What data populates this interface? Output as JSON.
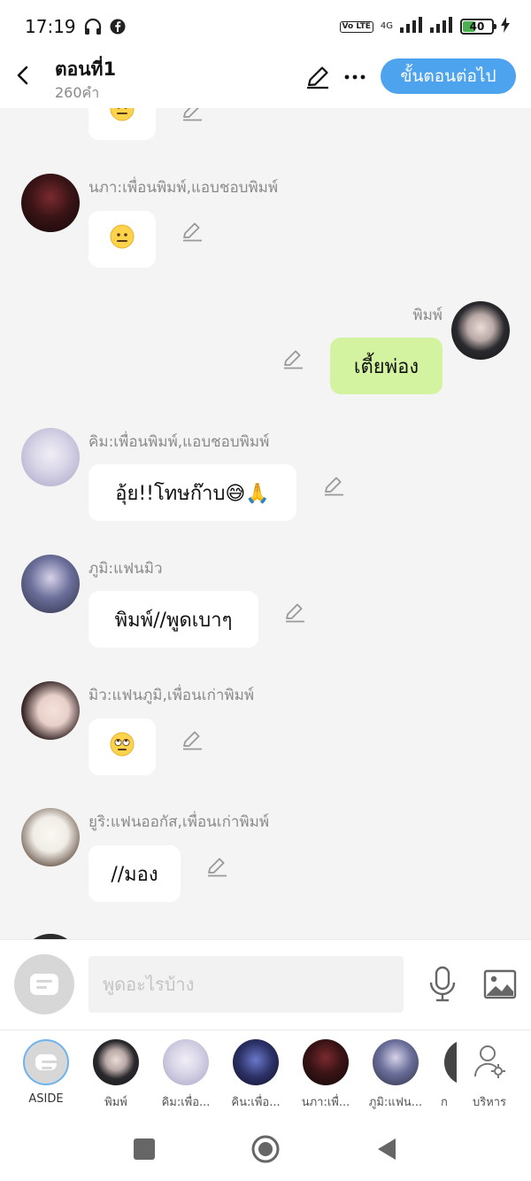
{
  "status_bar": {
    "time": "17:19",
    "network_label": "4G",
    "volte_label": "Vo LTE",
    "battery_level": "40"
  },
  "header": {
    "title": "ตอนที่1",
    "subtitle": "260คำ",
    "next_label": "ขั้นตอนต่อไป"
  },
  "messages": [
    {
      "sender": "",
      "text": "",
      "emoji": "neutral-face"
    },
    {
      "sender": "นภา:เพื่อนพิมพ์,แอบชอบพิมพ์",
      "text": "",
      "emoji": "neutral-face",
      "avatar_color": "#3a1416"
    },
    {
      "sender": "พิมพ์",
      "text": "เตี้ยพ่อง",
      "mine": true,
      "avatar_color": "#2a2a2e"
    },
    {
      "sender": "คิม:เพื่อนพิมพ์,แอบชอบพิมพ์",
      "text": "อุ้ย!!โทษก๊าบ😅🙏",
      "avatar_color": "#d9d6e8"
    },
    {
      "sender": "ภูมิ:แฟนมิว",
      "text": "พิมพ์//พูดเบาๆ",
      "avatar_color": "#6b6f9a"
    },
    {
      "sender": "มิว:แฟนภูมิ,เพื่อนเก่าพิมพ์",
      "text": "",
      "emoji": "eye-roll-face",
      "avatar_color": "#e8cfc9"
    },
    {
      "sender": "ยูริ:แฟนออกัส,เพื่อนเก่าพิมพ์",
      "text": "//มอง",
      "avatar_color": "#f0ece6"
    }
  ],
  "input": {
    "placeholder": "พูดอะไรบ้าง"
  },
  "characters": [
    {
      "label": "ASIDE",
      "selected": true
    },
    {
      "label": "พิมพ์",
      "avatar_color": "#2a2a2e"
    },
    {
      "label": "คิม:เพื่อ...",
      "avatar_color": "#d9d6e8"
    },
    {
      "label": "คิน:เพื่อ...",
      "avatar_color": "#2c3166"
    },
    {
      "label": "นภา:เพื่...",
      "avatar_color": "#3a1416"
    },
    {
      "label": "ภูมิ:แฟน...",
      "avatar_color": "#6b6f9a"
    },
    {
      "label": "ก",
      "avatar_color": "#444444"
    },
    {
      "label": "บริหาร",
      "icon": "user-settings-icon"
    }
  ],
  "colors": {
    "accent": "#4da3ee",
    "my_bubble": "#d4f3a0",
    "background": "#f4f4f4"
  }
}
